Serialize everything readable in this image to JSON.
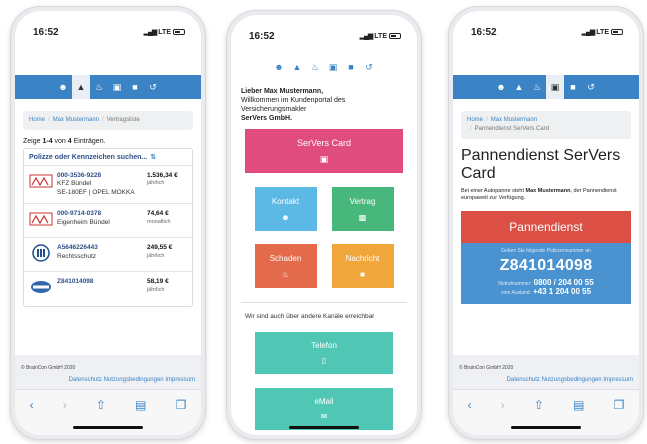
{
  "colors": {
    "nav": "#3a84c6",
    "card": "#e04c7e",
    "kontakt": "#5cb8e4",
    "vertrag": "#48b77b",
    "schaden": "#e36a4a",
    "nachricht": "#f1a63c",
    "channel": "#4fc7b4",
    "pannendienst_head": "#db4f45",
    "pannendienst_body": "#4a93d0"
  },
  "status": {
    "time": "16:52",
    "network": "LTE"
  },
  "nav_icons": [
    "user-icon",
    "bank-icon",
    "flame-icon",
    "card-icon",
    "chat-icon",
    "logout-icon"
  ],
  "screen1": {
    "breadcrumb": {
      "home": "Home",
      "user": "Max Mustermann",
      "current": "Vertragsliste"
    },
    "count": {
      "prefix": "Zeige ",
      "range": "1-4",
      "middle": " von ",
      "total": "4",
      "suffix": " Einträgen."
    },
    "search_label": "Polizze oder Kennzeichen suchen...",
    "rows": [
      {
        "number": "000-3536-9228",
        "line1": "KFZ Bündel",
        "line2": "SE-180EF | OPEL MOKKA",
        "amount": "1.536,34 €",
        "period": "jährlich"
      },
      {
        "number": "000-9714-0378",
        "line1": "Eigenheim Bündel",
        "line2": "",
        "amount": "74,64 €",
        "period": "monatlich"
      },
      {
        "number": "A5646226443",
        "line1": "Rechtsschutz",
        "line2": "",
        "amount": "249,55 €",
        "period": "jährlich"
      },
      {
        "number": "Z841014098",
        "line1": "",
        "line2": "",
        "amount": "58,19 €",
        "period": "jährlich"
      }
    ]
  },
  "footer": {
    "copyright": "© BrainCon GmbH 2020",
    "links": "Datenschutz Nutzungsbedingungen Impressum"
  },
  "screen2": {
    "greeting": "Lieber Max Mustermann,",
    "welcome_text": "Willkommen im Kundenportal des Versicherungsmakler",
    "company": "SerVers GmbH.",
    "card_button": "SerVers Card",
    "tiles": {
      "kontakt": "Kontakt",
      "vertrag": "Vertrag",
      "schaden": "Schaden",
      "nachricht": "Nachricht"
    },
    "channels_text": "Wir sind auch über andere Kanäle erreichbar",
    "telefon": "Telefon",
    "email": "eMail"
  },
  "screen3": {
    "breadcrumb": {
      "home": "Home",
      "user": "Max Mustermann",
      "current": "Pannendienst SerVers Card"
    },
    "title": "Pannendienst SerVers Card",
    "text_prefix": "Bei einer Autopanne steht ",
    "text_name": "Max Mustermann",
    "text_suffix": ", der Pannendienst europaweit zur Verfügung.",
    "header": "Pannendienst",
    "hint": "Geben Sie folgende Polizzennummer an",
    "policy": "Z841014098",
    "notruf_label": "Notrufnummer:",
    "notruf": "0800 / 204 00 55",
    "ausland_label": "vom Ausland:",
    "ausland": "+43 1 204 00 55"
  }
}
